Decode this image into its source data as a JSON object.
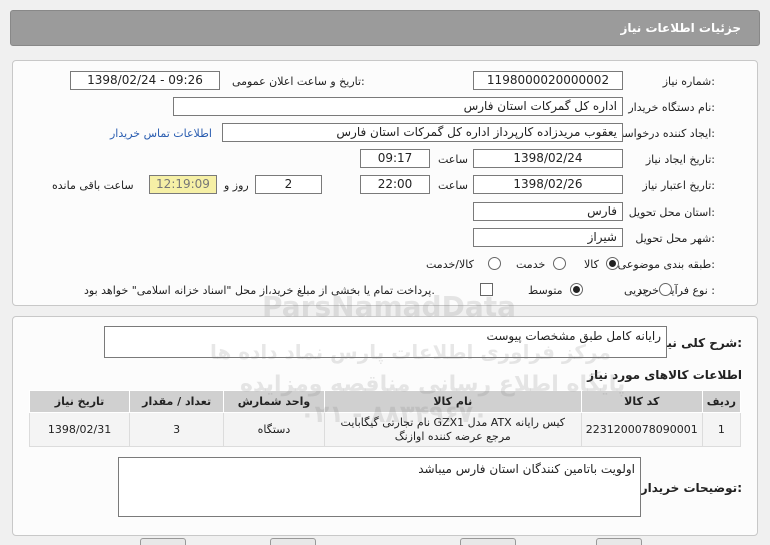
{
  "header": {
    "title": "جزئیات اطلاعات نیاز"
  },
  "form": {
    "need_number_label": "شماره نیاز:",
    "need_number": "1198000020000002",
    "announce_label": "تاریخ و ساعت اعلان عمومی:",
    "announce_value": "1398/02/24 - 09:26",
    "buyer_org_label": "نام دستگاه خریدار:",
    "buyer_org": "اداره کل گمرکات استان فارس",
    "requester_label": "ایجاد کننده درخواست:",
    "requester": "یعقوب مریدزاده کارپرداز اداره کل گمرکات استان فارس",
    "contact_link": "اطلاعات تماس خریدار",
    "created_label": "تاریخ ایجاد نیاز:",
    "created_date": "1398/02/24",
    "time_label": "ساعت",
    "created_time": "09:17",
    "validity_label": "تاریخ اعتبار نیاز:",
    "validity_date": "1398/02/26",
    "validity_time": "22:00",
    "days": "2",
    "days_label": "روز و",
    "remaining": "12:19:09",
    "remaining_label": "ساعت باقی مانده",
    "province_label": "استان محل تحویل:",
    "province": "فارس",
    "city_label": "شهر محل تحویل:",
    "city": "شیراز",
    "category_label": "طبقه بندی موضوعی:",
    "category_options": [
      "کالا",
      "خدمت",
      "کالا/خدمت"
    ],
    "category_selected": "کالا",
    "process_label": "نوع فرآیند خرید :",
    "process_options": [
      "جزیی",
      "متوسط"
    ],
    "process_selected": "متوسط",
    "payment_note": "پرداخت تمام یا بخشی از مبلغ خرید،از محل \"اسناد خزانه اسلامی\" خواهد بود."
  },
  "summary": {
    "label": "شرح کلی نیاز:",
    "text": "رایانه کامل طبق مشخصات پیوست"
  },
  "items": {
    "title": "اطلاعات کالاهای مورد نیاز",
    "columns": [
      "ردیف",
      "کد کالا",
      "نام کالا",
      "واحد شمارش",
      "تعداد / مقدار",
      "تاریخ نیاز"
    ],
    "rows": [
      {
        "index": "1",
        "code": "2231200078090001",
        "name": "کیس رایانه ATX مدل GZX1 نام تجارتی گیگابایت مرجع عرضه کننده اوازنگ",
        "unit": "دستگاه",
        "qty": "3",
        "date": "1398/02/31"
      }
    ]
  },
  "notes": {
    "label": "توضیحات خریدار:",
    "text": "اولویت باتامین کنندگان استان فارس میباشد"
  },
  "watermark": {
    "line1": "ParsNamadData",
    "line2": "مرکز فراوری اطلاعات پارس نماد داده ها",
    "line3": "پایگاه اطلاع رسانی مناقصه ومزایده",
    "line4": "۰۲۱ - ۸۸۳۴۹۶۷۰"
  }
}
